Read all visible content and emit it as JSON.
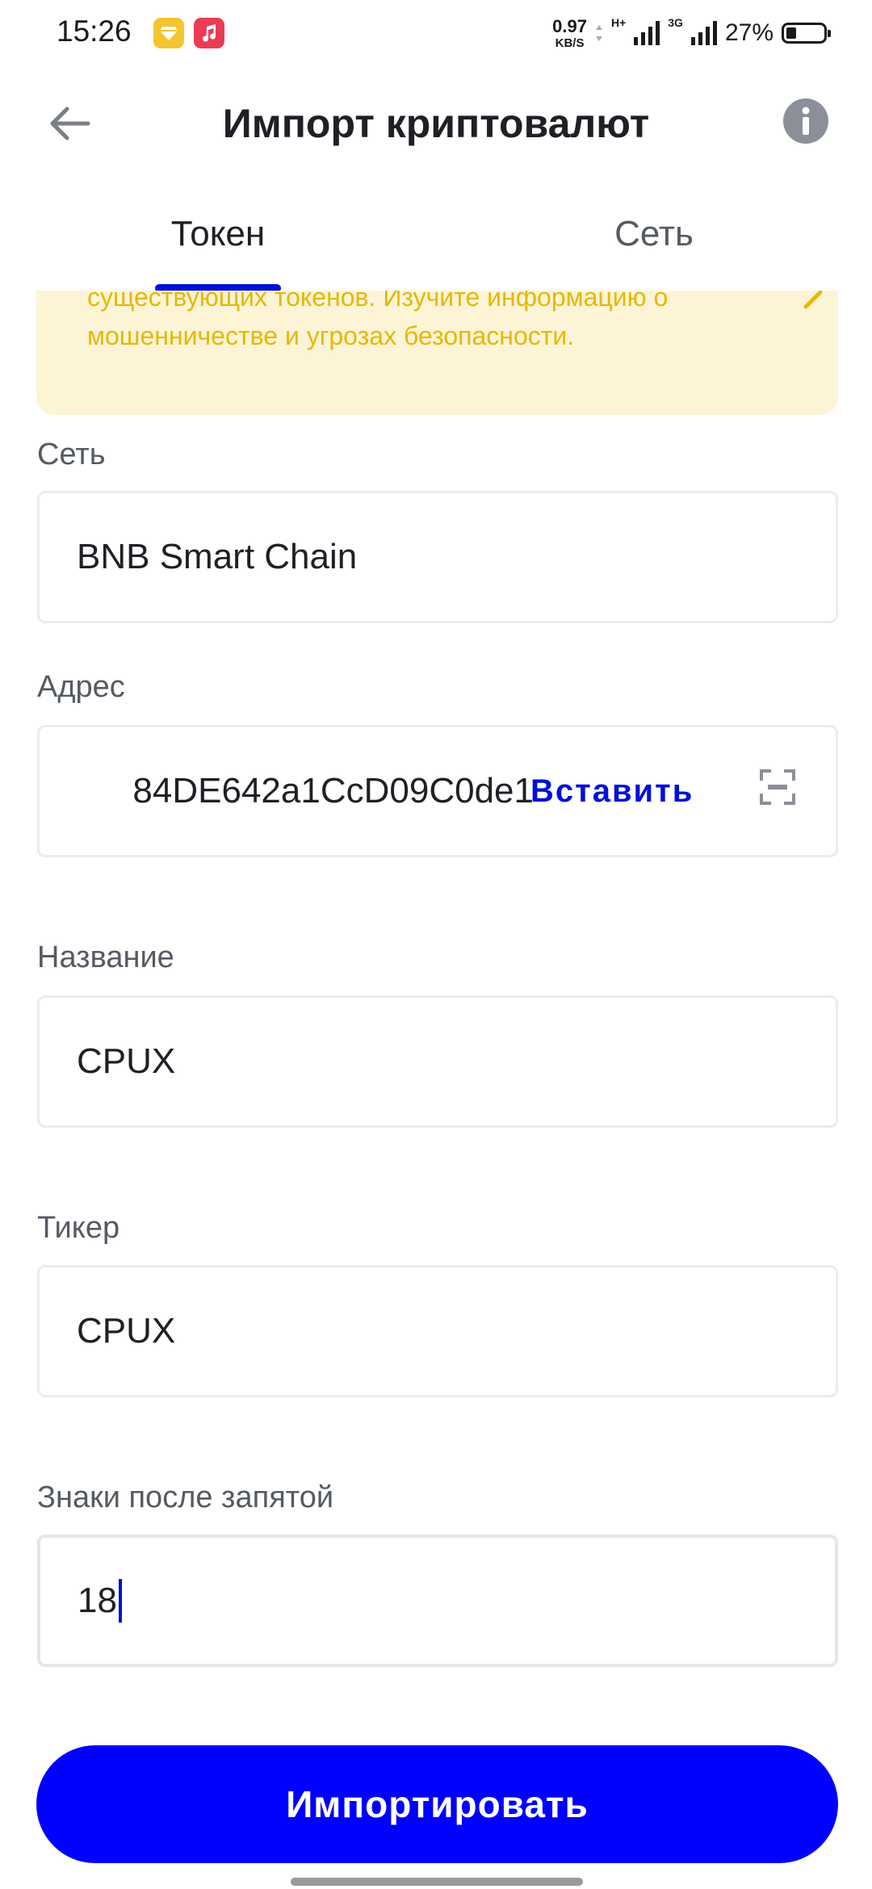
{
  "status_bar": {
    "time": "15:26",
    "net_speed_value": "0.97",
    "net_speed_unit": "KB/S",
    "signal1_label": "H+",
    "signal2_label": "3G",
    "battery_percent": "27%",
    "battery_level": 0.27,
    "icons": [
      "app-notification-icon",
      "music-app-icon",
      "signal-icon",
      "signal-icon",
      "battery-icon"
    ]
  },
  "header": {
    "title": "Импорт криптовалют",
    "back_icon": "arrow-left-icon",
    "info_icon": "info-icon"
  },
  "tabs": [
    {
      "label": "Токен",
      "active": true
    },
    {
      "label": "Сеть",
      "active": false
    }
  ],
  "warning": {
    "text": "существующих токенов. Изучите информацию о мошенничестве и угрозах безопасности.",
    "icon": "chevron-icon"
  },
  "form": {
    "network": {
      "label": "Сеть",
      "value": "BNB Smart Chain"
    },
    "address": {
      "label": "Адрес",
      "value": "84DE642a1CcD09C0de1",
      "paste_label": "Вставить",
      "scan_icon": "scan-icon"
    },
    "name": {
      "label": "Название",
      "value": "CPUX"
    },
    "ticker": {
      "label": "Тикер",
      "value": "CPUX"
    },
    "decimals": {
      "label": "Знаки после запятой",
      "value": "18"
    }
  },
  "import_button": {
    "label": "Импортировать"
  },
  "colors": {
    "accent": "#0000ff",
    "link": "#0010d8",
    "warning_bg": "#fdf4d6",
    "warning_text": "#e6b800"
  }
}
